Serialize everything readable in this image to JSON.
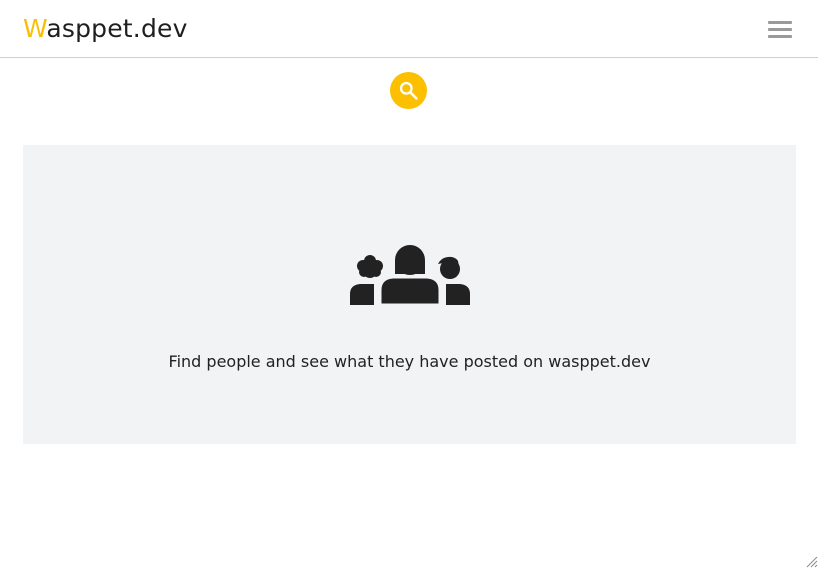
{
  "header": {
    "logo_first_letter": "W",
    "logo_rest": "asppet.dev",
    "menu_icon": "hamburger-menu-icon"
  },
  "search": {
    "icon": "search-icon"
  },
  "empty_state": {
    "icon": "people-group-icon",
    "message": "Find people and see what they have posted on wasppet.dev"
  },
  "colors": {
    "accent": "#fcc000",
    "panel_background": "#f2f3f5",
    "header_border": "#cfcfcf",
    "text": "#222222"
  }
}
